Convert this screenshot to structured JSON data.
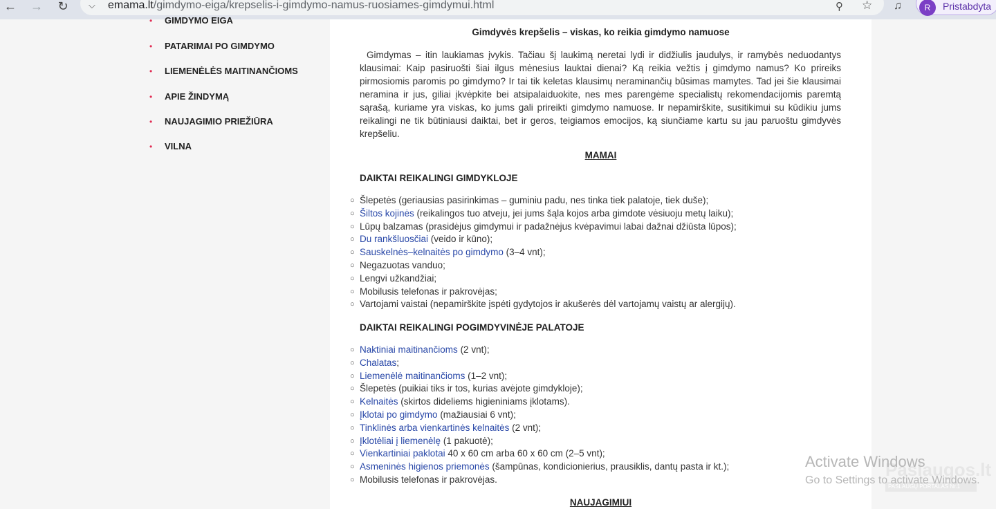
{
  "browser": {
    "back_icon": "←",
    "forward_icon": "→",
    "reload_icon": "↻",
    "chevron": "⌵",
    "url_domain": "emama.lt",
    "url_path": "/gimdymo-eiga/krepselis-i-gimdymo-namus-ruosiames-gimdymui.html",
    "zoom_icon": "⚲",
    "star_icon": "☆",
    "media_icon": "♫",
    "profile_initial": "R",
    "profile_label": "Pristabdyta"
  },
  "sidebar": {
    "bullet": "•",
    "items": [
      {
        "label": "GIMDYMO EIGA"
      },
      {
        "label": "PATARIMAI PO GIMDYMO"
      },
      {
        "label": "LIEMENĖLĖS MAITINANČIOMS"
      },
      {
        "label": "APIE ŽINDYMĄ"
      },
      {
        "label": "NAUJAGIMIO PRIEŽIŪRA"
      },
      {
        "label": "VILNA"
      }
    ]
  },
  "article": {
    "title": "Gimdyvės krepšelis – viskas, ko reikia gimdymo namuose",
    "intro": "Gimdymas – itin laukiamas įvykis. Tačiau šį laukimą neretai lydi ir didžiulis jaudulys, ir ramybės neduodantys klausimai: Kaip pasiruošti šiai ilgus mėnesius lauktai dienai? Ką reikia vežtis į gimdymo namus? Ko prireiks pirmosiomis paromis po gimdymo? Ir tai tik keletas klausimų neraminančių būsimas mamytes. Tad jei šie klausimai neramina ir jus, giliai įkvėpkite bei atsipalaiduokite, nes mes parengėme specialistų rekomendacijomis paremtą sąrašą, kuriame yra viskas, ko jums gali prireikti gimdymo namuose. Ir nepamirškite, susitikimui su kūdikiu jums reikalingi ne tik būtiniausi daiktai, bet ir geros, teigiamos emocijos, ką siunčiame kartu su jau paruoštu gimdyvės krepšeliu.",
    "section_mamai": "MAMAI",
    "heading1": "DAIKTAI REIKALINGI GIMDYKLOJE",
    "list1": [
      {
        "link": "",
        "text": "Šlepetės (geriausias pasirinkimas – guminiu padu, nes tinka tiek palatoje, tiek duše);"
      },
      {
        "link": "Šiltos kojinės",
        "text": " (reikalingos tuo atveju, jei jums šąla kojos arba gimdote vėsiuoju metų laiku);"
      },
      {
        "link": "",
        "text": "Lūpų balzamas (prasidėjus gimdymui ir padažnėjus kvėpavimui labai dažnai džiūsta lūpos);"
      },
      {
        "link": "Du rankšluosčiai",
        "text": " (veido ir kūno);"
      },
      {
        "link": "Sauskelnės–kelnaitės po gimdymo",
        "text": " (3–4 vnt);"
      },
      {
        "link": "",
        "text": "Negazuotas vanduo;"
      },
      {
        "link": "",
        "text": "Lengvi užkandžiai;"
      },
      {
        "link": "",
        "text": "Mobilusis telefonas ir pakrovėjas;"
      },
      {
        "link": "",
        "text": "Vartojami vaistai (nepamirškite įspėti gydytojos ir akušerės dėl vartojamų vaistų ar alergijų)."
      }
    ],
    "heading2": "DAIKTAI REIKALINGI POGIMDYVINĖJE PALATOJE",
    "list2": [
      {
        "link": "Naktiniai maitinančioms",
        "text": " (2 vnt);"
      },
      {
        "link": "Chalatas",
        "text": ";"
      },
      {
        "link": "Liemenėlė maitinančioms",
        "text": " (1–2 vnt);"
      },
      {
        "link": "",
        "text": "Šlepetės (puikiai tiks ir tos, kurias avėjote gimdykloje);"
      },
      {
        "link": "Kelnaitės",
        "text": " (skirtos dideliems higieniniams įklotams)."
      },
      {
        "link": "Įklotai po gimdymo",
        "text": " (mažiausiai 6 vnt);"
      },
      {
        "link": "Tinklinės arba vienkartinės kelnaitės",
        "text": " (2 vnt);"
      },
      {
        "link": "Įklotėliai į liemenėlę",
        "text": " (1 pakuotė);"
      },
      {
        "link": "Vienkartiniai paklotai",
        "text": " 40 x 60 cm arba 60 x 60 cm (2–5 vnt);"
      },
      {
        "link": "Asmeninės higienos priemonės",
        "text": " (šampūnas, kondicionierius, prausiklis, dantų pasta ir kt.);"
      },
      {
        "link": "",
        "text": "Mobilusis telefonas ir pakrovėjas."
      }
    ],
    "section_naujagimiui": "NAUJAGIMIUI",
    "list_bullet": "○"
  },
  "watermark": {
    "activate_title": "Activate Windows",
    "activate_sub": "Go to Settings to activate Windows.",
    "logo_big": "Paslaugos.lt",
    "logo_small": "PASLAUGŲ PORTALAS     Nr.1"
  }
}
